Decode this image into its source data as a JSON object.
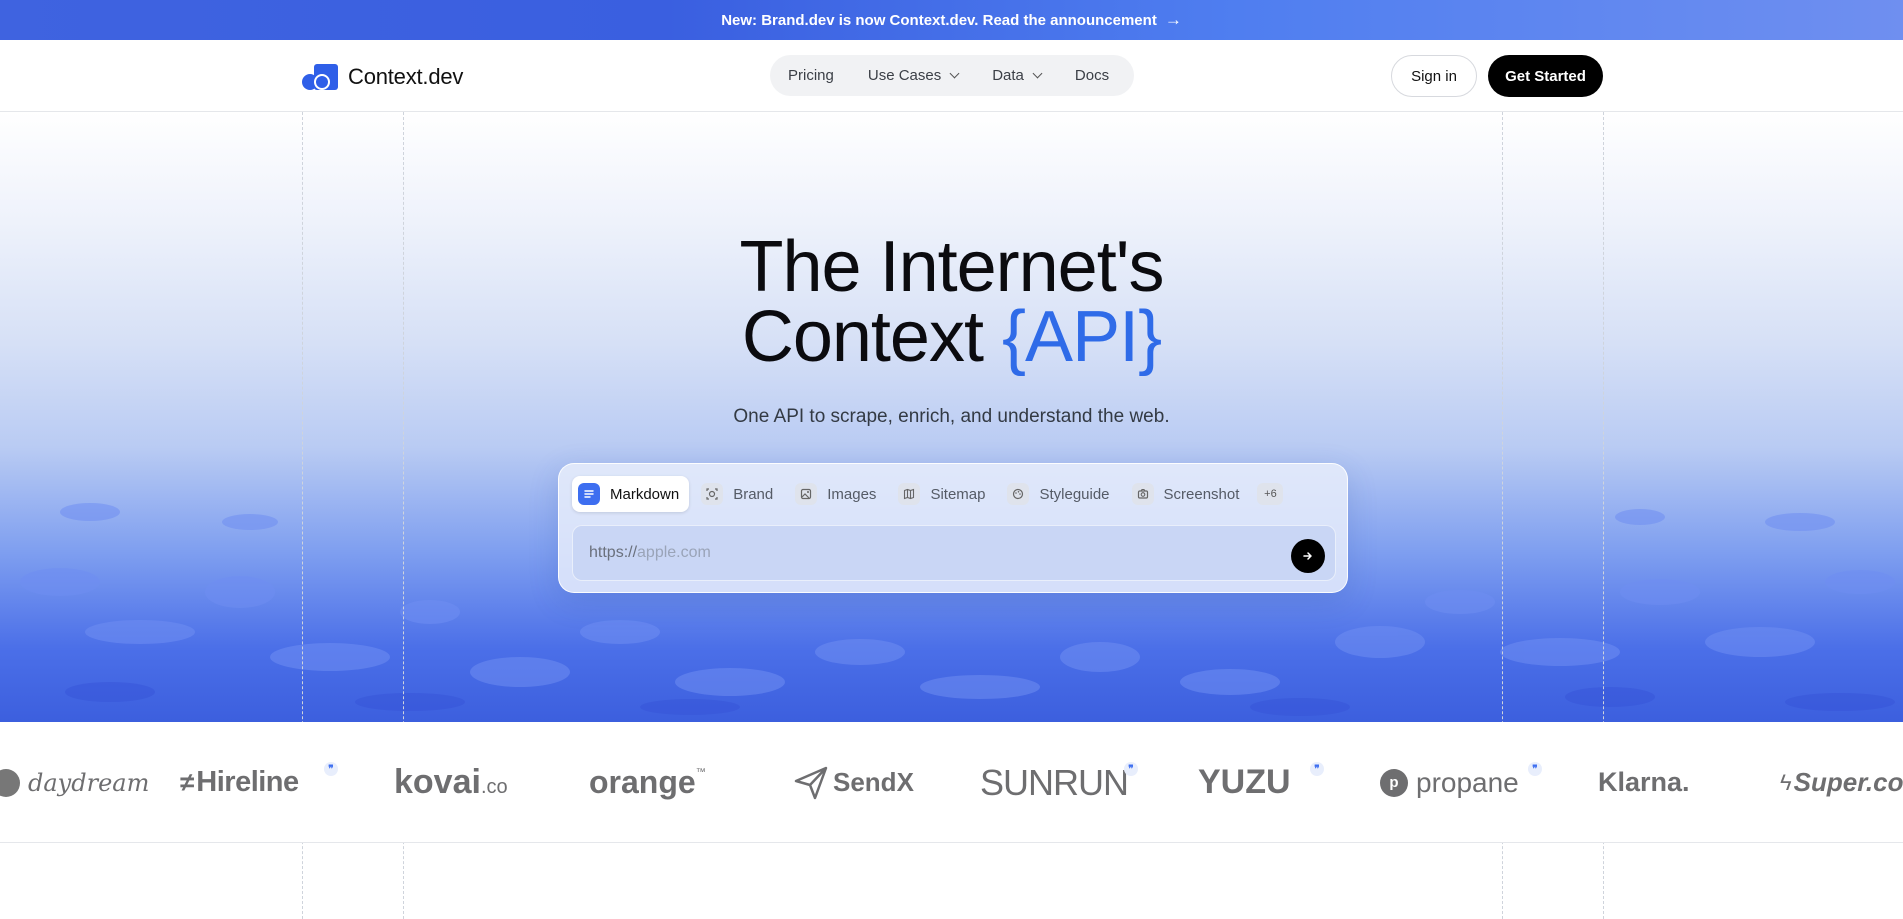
{
  "announcement": {
    "text": "New: Brand.dev is now Context.dev. Read the announcement",
    "arrow": "→"
  },
  "header": {
    "logo_text": "Context.dev",
    "nav": [
      {
        "label": "Pricing",
        "dropdown": false
      },
      {
        "label": "Use Cases",
        "dropdown": true
      },
      {
        "label": "Data",
        "dropdown": true
      },
      {
        "label": "Docs",
        "dropdown": false
      }
    ],
    "sign_in": "Sign in",
    "get_started": "Get Started"
  },
  "hero": {
    "title_line1": "The Internet's",
    "title_line2_prefix": "Context",
    "title_line2_accent": "{API}",
    "subtitle": "One API to scrape, enrich, and understand the web.",
    "tabs": [
      {
        "label": "Markdown",
        "icon": "document-lines-icon",
        "active": true
      },
      {
        "label": "Brand",
        "icon": "brand-scan-icon",
        "active": false
      },
      {
        "label": "Images",
        "icon": "image-icon",
        "active": false
      },
      {
        "label": "Sitemap",
        "icon": "map-icon",
        "active": false
      },
      {
        "label": "Styleguide",
        "icon": "palette-icon",
        "active": false
      },
      {
        "label": "Screenshot",
        "icon": "camera-icon",
        "active": false
      }
    ],
    "more_tabs": "+6",
    "url_prefix": "https://",
    "url_placeholder": "apple.com"
  },
  "logos": [
    "daydream",
    "Hireline",
    "kovai",
    ".co",
    "orange",
    "™",
    "SendX",
    "SUNRUN",
    "YUZU",
    "propane",
    "Klarna.",
    "Super.com"
  ],
  "colors": {
    "accent": "#2f6be8",
    "brand": "#2f5fe8",
    "dark": "#000000"
  }
}
